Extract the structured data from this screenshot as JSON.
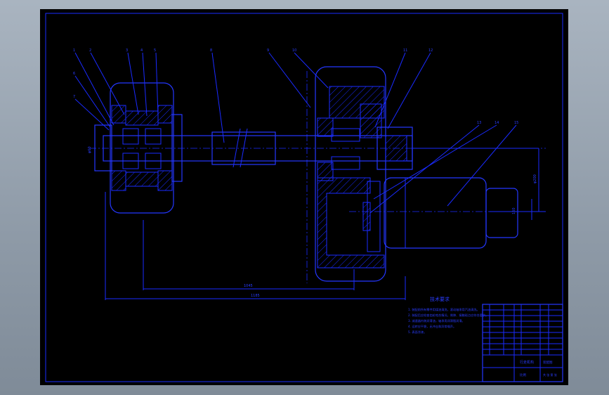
{
  "drawing": {
    "notes_title": "技术要求",
    "notes": [
      "1. 装配前所有零件用煤油清洗，滚动轴承用汽油清洗。",
      "2. 装配后应检查齿轮啮合情况，侧隙、接触斑点应符合要求。",
      "3. 减速器内装润滑油，轴承用润滑脂润滑。",
      "4. 运转应平稳，无冲击和异常噪声。",
      "5. 表面涂漆。"
    ],
    "dimensions": {
      "inner_span": "1045",
      "total_span": "1185",
      "motor_height": "φ200",
      "motor_offset": "160",
      "shaft_dia": "φ60"
    },
    "balloon_labels": [
      "1",
      "2",
      "3",
      "4",
      "5",
      "6",
      "7",
      "8",
      "9",
      "10",
      "11",
      "12",
      "13",
      "14",
      "15",
      "16",
      "17",
      "18",
      "19"
    ],
    "title_block": {
      "title": "行走机构",
      "drawing_no": "装配图",
      "scale_label": "比例",
      "sheet_label": "共 张 第 张"
    }
  }
}
